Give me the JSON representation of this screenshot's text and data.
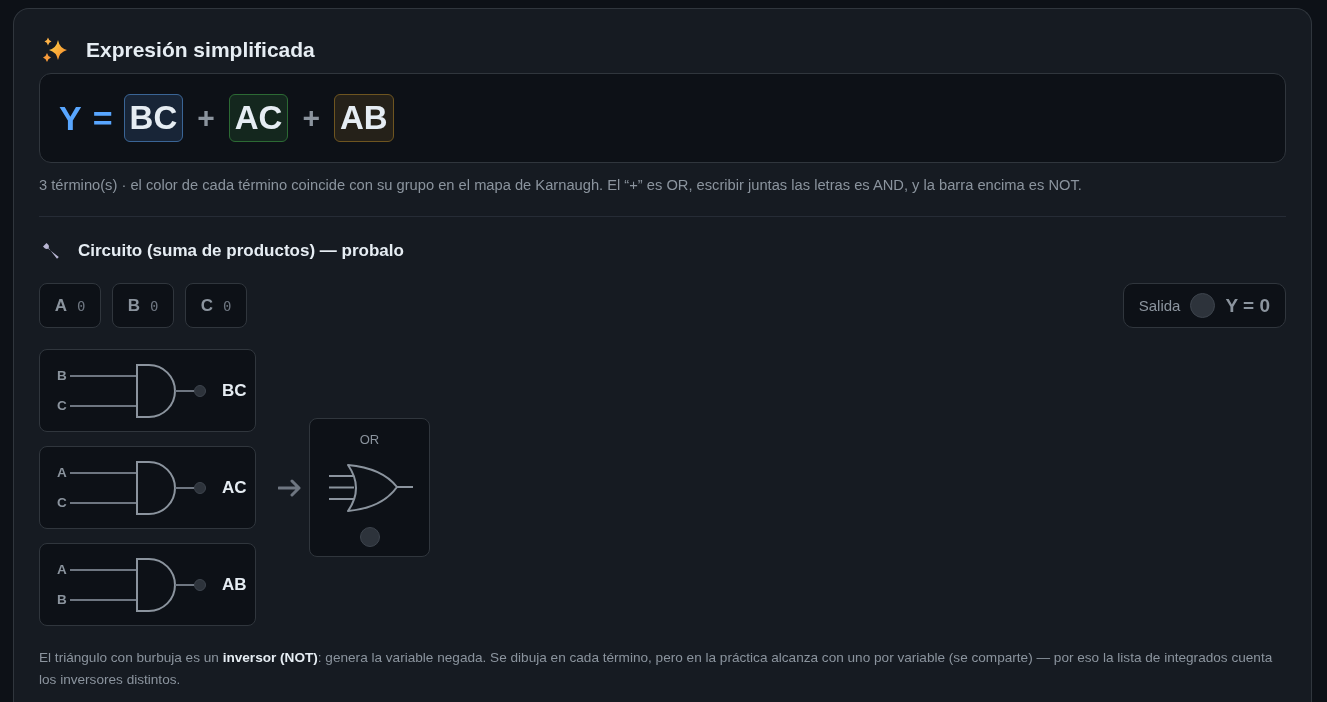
{
  "expression": {
    "title": "Expresión simplificada",
    "output": "Y",
    "equals": "=",
    "terms": [
      {
        "label": "BC",
        "color": "#3a6596"
      },
      {
        "label": "AC",
        "color": "#2c6a34"
      },
      {
        "label": "AB",
        "color": "#6e5520"
      }
    ],
    "operators": [
      "+",
      "+"
    ],
    "caption": "3 término(s) · el color de cada término coincide con su grupo en el mapa de Karnaugh. El “+” es OR, escribir juntas las letras es AND, y la barra encima es NOT."
  },
  "circuit": {
    "title": "Circuito (suma de productos) — probalo",
    "inputs": [
      {
        "name": "A",
        "value": "0",
        "on": false
      },
      {
        "name": "B",
        "value": "0",
        "on": false
      },
      {
        "name": "C",
        "value": "0",
        "on": false
      }
    ],
    "output": {
      "label": "Salida",
      "value": "Y = 0",
      "on": false
    },
    "and_gates": [
      {
        "inputs": [
          "B",
          "C"
        ],
        "term": "BC",
        "on": false
      },
      {
        "inputs": [
          "A",
          "C"
        ],
        "term": "AC",
        "on": false
      },
      {
        "inputs": [
          "A",
          "B"
        ],
        "term": "AB",
        "on": false
      }
    ],
    "or_gate": {
      "label": "OR",
      "on": false
    },
    "note": "El triángulo con burbuja es un **inversor (NOT)**: genera la variable negada. Se dibuja en cada término, pero en la práctica alcanza con uno por variable (se comparte) — por eso la lista de integrados cuenta los inversores distintos."
  }
}
